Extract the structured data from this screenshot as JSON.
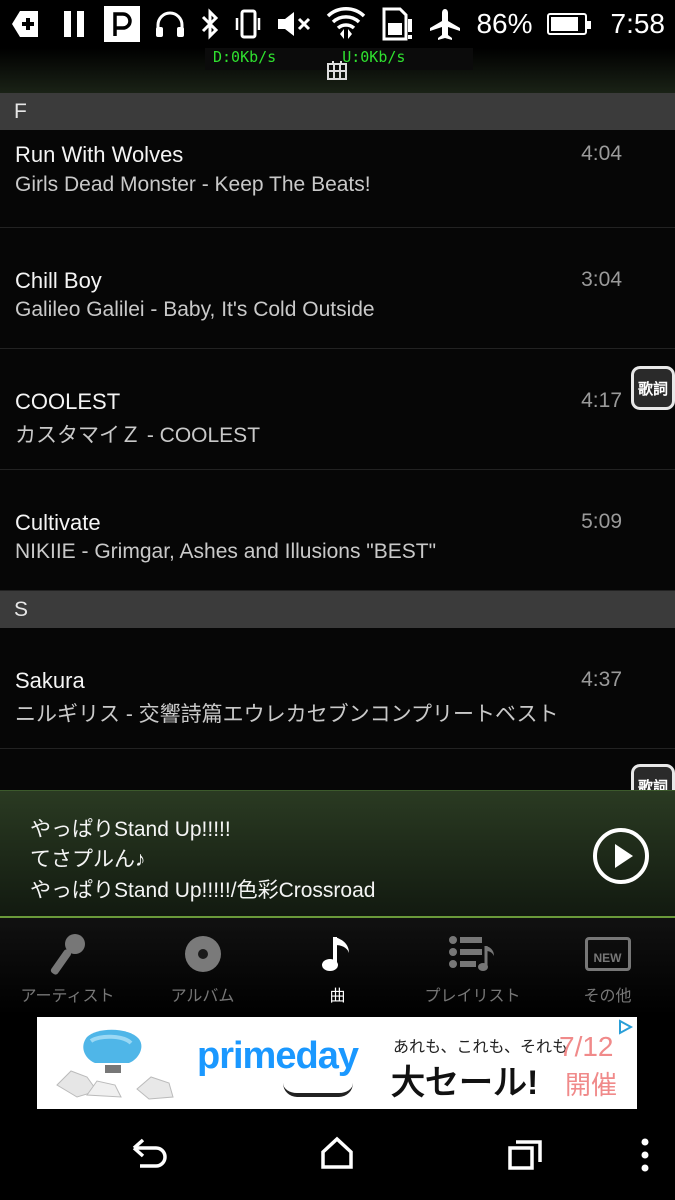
{
  "status_bar": {
    "battery_percent": "86%",
    "battery_level": 0.86,
    "time": "7:58",
    "icons": [
      "add-box-icon",
      "pause-icon",
      "app-p-icon",
      "headphones-icon",
      "bluetooth-icon",
      "phone-vibrate-icon",
      "mute-icon",
      "wifi-icon",
      "sim-alert-icon",
      "airplane-icon",
      "battery-icon"
    ]
  },
  "traffic": {
    "download": "D:0Kb/s",
    "upload": "U:0Kb/s"
  },
  "sections": [
    {
      "letter": "F",
      "songs": [
        {
          "title": "Run With Wolves",
          "subtitle": "Girls Dead Monster - Keep The Beats!",
          "duration": "4:04",
          "lyrics": ""
        },
        {
          "title": "Chill Boy",
          "subtitle": "Galileo Galilei - Baby, It's Cold Outside",
          "duration": "3:04",
          "lyrics": ""
        },
        {
          "title": "COOLEST",
          "subtitle": "カスタマイＺ - COOLEST",
          "duration": "4:17",
          "lyrics": "歌詞"
        },
        {
          "title": "Cultivate",
          "subtitle": "NIKIIE - Grimgar, Ashes and Illusions \"BEST\"",
          "duration": "5:09",
          "lyrics": ""
        }
      ]
    },
    {
      "letter": "S",
      "songs": [
        {
          "title": "Sakura",
          "subtitle": "ニルギリス - 交響詩篇エウレカセブンコンプリートベスト",
          "duration": "4:37",
          "lyrics": ""
        },
        {
          "title": "",
          "subtitle": "",
          "duration": "",
          "lyrics": "歌詞"
        }
      ]
    }
  ],
  "now_playing": {
    "title": "やっぱりStand Up!!!!!",
    "artist": "てさプルん♪",
    "album": "やっぱりStand Up!!!!!/色彩Crossroad"
  },
  "tabs": [
    {
      "label": "アーティスト",
      "icon": "microphone-icon",
      "active": false
    },
    {
      "label": "アルバム",
      "icon": "disc-icon",
      "active": false
    },
    {
      "label": "曲",
      "icon": "music-note-icon",
      "active": true
    },
    {
      "label": "プレイリスト",
      "icon": "playlist-icon",
      "active": false
    },
    {
      "label": "その他",
      "icon": "new-badge-icon",
      "active": false
    }
  ],
  "tab_new_badge": "NEW",
  "ad": {
    "brand": "primeday",
    "copy": "あれも、これも、それも",
    "sale": "大セール!",
    "date": "7/12",
    "date_suffix": "開催"
  },
  "colors": {
    "accent_green": "#6a9a3a",
    "traffic_text": "#2fe02f",
    "section_header": "#3b3b3b",
    "brand_blue": "#1a98ff",
    "ad_date": "#f08a8a"
  }
}
